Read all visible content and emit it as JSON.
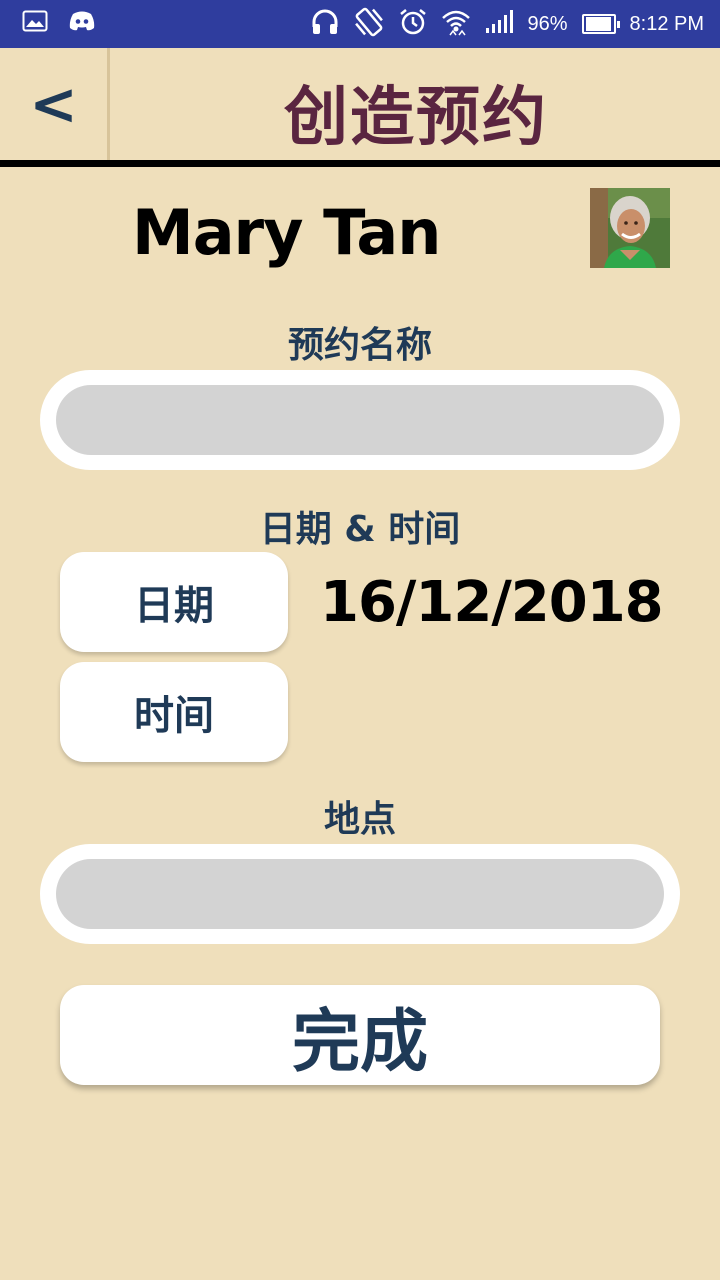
{
  "status_bar": {
    "battery": "96%",
    "time": "8:12 PM",
    "battery_level": 0.96,
    "icons": [
      "gallery-icon",
      "discord-icon",
      "headphones-icon",
      "vibrate-icon",
      "alarm-icon",
      "wifi-icon",
      "signal-icon",
      "battery-icon"
    ]
  },
  "header": {
    "back_label": "<",
    "title": "创造预约"
  },
  "user": {
    "name": "Mary Tan"
  },
  "form": {
    "name_label": "预约名称",
    "name_value": "",
    "datetime_label": "日期 & 时间",
    "date_button": "日期",
    "date_value": "16/12/2018",
    "time_button": "时间",
    "location_label": "地点",
    "location_value": "",
    "done_button": "完成"
  },
  "colors": {
    "background": "#efdfbb",
    "status_bar": "#2f3d9e",
    "title": "#5a2540",
    "label": "#1f3a57",
    "field": "#d3d3d3"
  }
}
